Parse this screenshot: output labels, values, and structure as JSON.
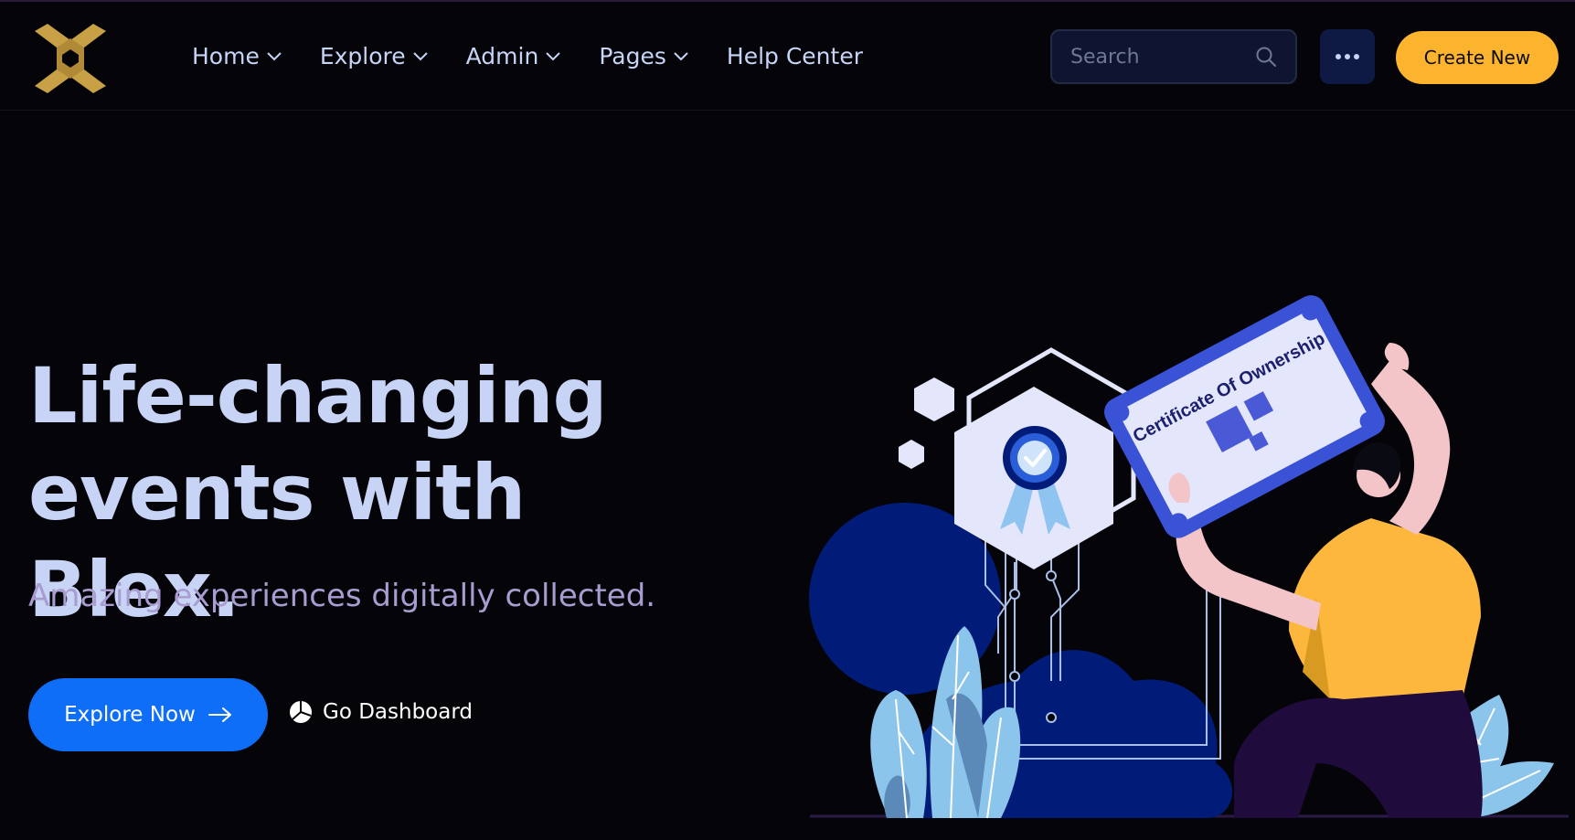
{
  "nav": {
    "items": [
      {
        "label": "Home",
        "has_dropdown": true
      },
      {
        "label": "Explore",
        "has_dropdown": true
      },
      {
        "label": "Admin",
        "has_dropdown": true
      },
      {
        "label": "Pages",
        "has_dropdown": true
      },
      {
        "label": "Help Center",
        "has_dropdown": false
      }
    ]
  },
  "search": {
    "placeholder": "Search",
    "icon": "search-icon"
  },
  "more_button": {
    "icon": "more-dots-icon"
  },
  "create_button": {
    "label": "Create New"
  },
  "hero": {
    "title_line1": "Life-changing",
    "title_line2": "events with Blex.",
    "subtitle": "Amazing experiences digitally collected.",
    "primary_button": {
      "label": "Explore Now",
      "icon": "arrow-right-icon"
    },
    "secondary_link": {
      "label": "Go Dashboard",
      "icon": "pie-chart-icon"
    }
  },
  "illustration": {
    "certificate_text": "Certificate Of Ownership"
  },
  "colors": {
    "background": "#050409",
    "accent_yellow": "#fcb32e",
    "primary_blue": "#0f6ef7",
    "logo_gold": "#c8a046",
    "text_light": "#c6d4f5",
    "subtitle": "#a89cd0"
  }
}
